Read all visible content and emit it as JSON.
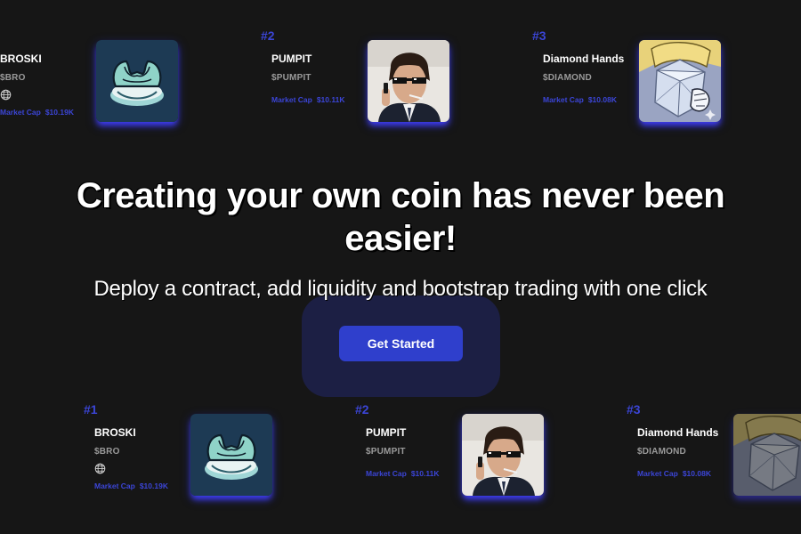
{
  "hero": {
    "title_line1": "Creating your own coin has never been",
    "title_line2": "easier!",
    "subtitle": "Deploy a contract, add liquidity and bootstrap trading with one click",
    "cta_label": "Get Started"
  },
  "top_row": [
    {
      "rank": "",
      "name": "BROSKI",
      "ticker": "$BRO",
      "has_website_icon": true,
      "mcap_label": "Market Cap",
      "mcap_value": "$10.19K",
      "image": "muscle-logo"
    },
    {
      "rank": "#2",
      "name": "PUMPIT",
      "ticker": "$PUMPIT",
      "has_website_icon": false,
      "mcap_label": "Market Cap",
      "mcap_value": "$10.11K",
      "image": "sunglasses-photo"
    },
    {
      "rank": "#3",
      "name": "Diamond Hands",
      "ticker": "$DIAMOND",
      "has_website_icon": false,
      "mcap_label": "Market Cap",
      "mcap_value": "$10.08K",
      "image": "diamond-fist"
    }
  ],
  "bottom_row": [
    {
      "rank": "#1",
      "name": "BROSKI",
      "ticker": "$BRO",
      "has_website_icon": true,
      "mcap_label": "Market Cap",
      "mcap_value": "$10.19K",
      "image": "muscle-logo"
    },
    {
      "rank": "#2",
      "name": "PUMPIT",
      "ticker": "$PUMPIT",
      "has_website_icon": false,
      "mcap_label": "Market Cap",
      "mcap_value": "$10.11K",
      "image": "sunglasses-photo"
    },
    {
      "rank": "#3",
      "name": "Diamond Hands",
      "ticker": "$DIAMOND",
      "has_website_icon": false,
      "mcap_label": "Market Cap",
      "mcap_value": "$10.08K",
      "image": "diamond-fist"
    }
  ],
  "colors": {
    "background": "#161616",
    "accent": "#2f3fcc",
    "rank": "#3b45d6",
    "ticker": "#9a9a9a"
  },
  "icons": {
    "website": "globe-icon"
  }
}
